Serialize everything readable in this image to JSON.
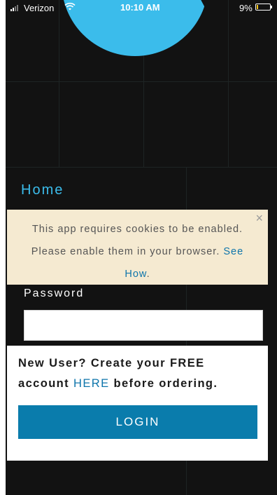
{
  "status_bar": {
    "carrier": "Verizon",
    "time": "10:10 AM",
    "battery_percent": "9%",
    "battery_level": 0.09,
    "signal_icon": "signal-bars-icon",
    "wifi_icon": "wifi-icon",
    "battery_icon": "battery-icon"
  },
  "page": {
    "title": "Home"
  },
  "cookie_notice": {
    "message": "This app requires cookies to be enabled. Please enable them in your browser.",
    "link_text": "See How",
    "trailing": ".",
    "close_symbol": "×"
  },
  "login_form": {
    "password_label": "Password",
    "password_value": "",
    "password_placeholder": ""
  },
  "signup": {
    "prefix": "New User?  Create your FREE account ",
    "link_text": "HERE",
    "suffix": " before ordering.",
    "login_button": "LOGIN"
  },
  "colors": {
    "background": "#121212",
    "accent": "#3bbceb",
    "button": "#0a7cac",
    "link": "#0e75ab",
    "notice_background": "#f5ead1"
  }
}
